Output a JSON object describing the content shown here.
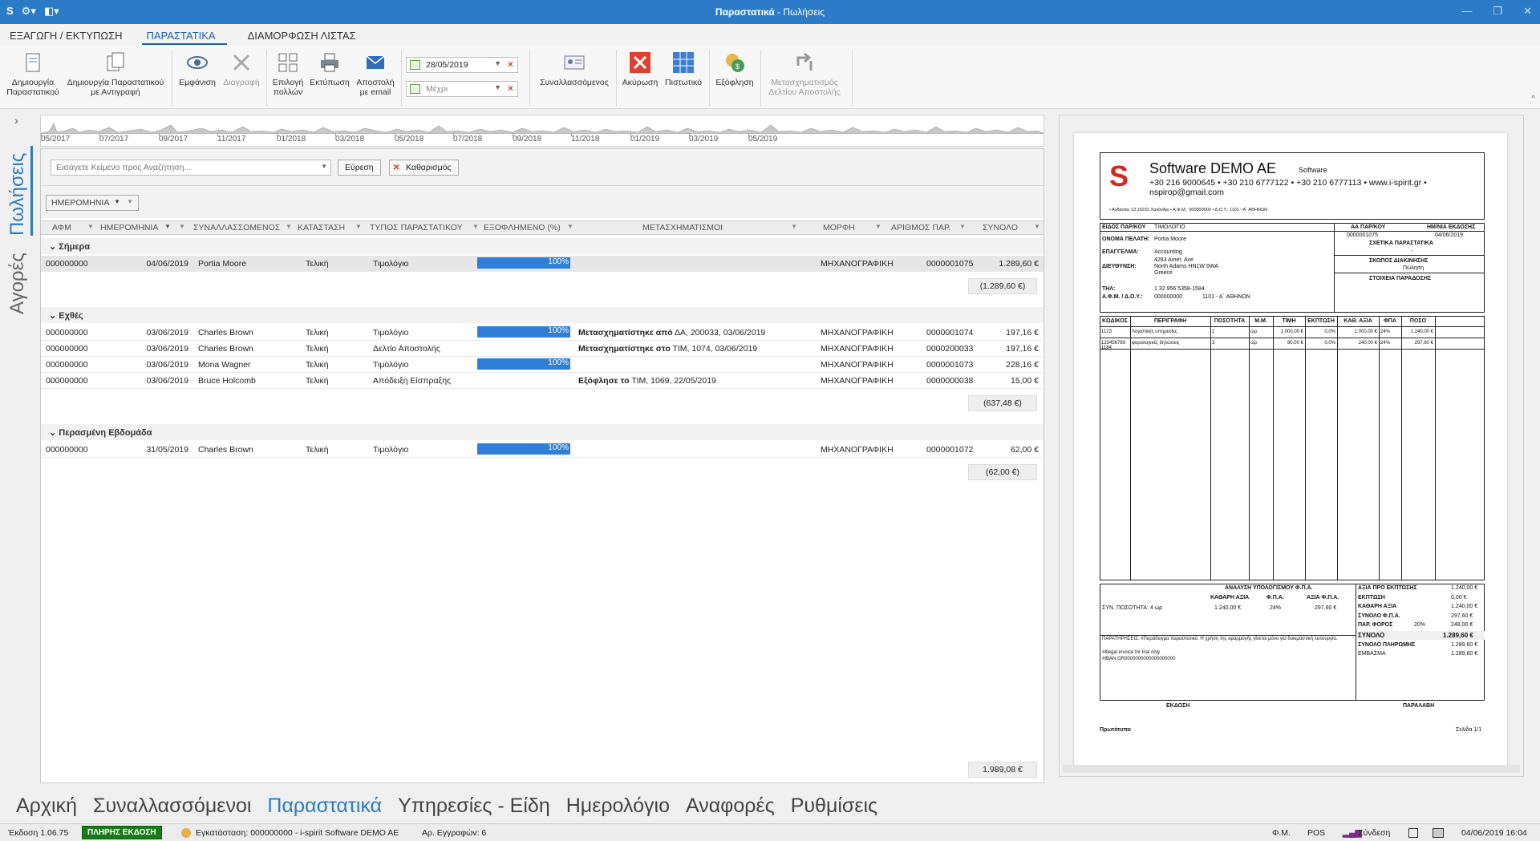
{
  "window": {
    "title": "Παραστατικά",
    "title_suffix": " - Πωλήσεις"
  },
  "ribbon_tabs": [
    "ΕΞΑΓΩΓΗ / ΕΚΤΥΠΩΣΗ",
    "ΠΑΡΑΣΤΑΤΙΚΑ",
    "ΔΙΑΜΟΡΦΩΣΗ ΛΙΣΤΑΣ"
  ],
  "ribbon": {
    "create": "Δημιουργία Παραστατικού",
    "create_copy": "Δημιουργία Παραστατικού με Αντιγραφή",
    "show": "Εμφάνιση",
    "delete": "Διαγραφή",
    "select_many": "Επιλογή πολλών",
    "print": "Εκτύπωση",
    "send_email": "Αποστολή με email",
    "date_from": "28/05/2019",
    "date_to_placeholder": "Μέχρι",
    "partners": "Συναλλασσόμενος",
    "cancel": "Ακύρωση",
    "credit": "Πιστωτικό",
    "settle": "Εξόφληση",
    "transform": "Μετασχηματισμός Δελτίου Αποστολής"
  },
  "timeline": {
    "labels": [
      "05/2017",
      "07/2017",
      "09/2017",
      "11/2017",
      "01/2018",
      "03/2018",
      "05/2018",
      "07/2018",
      "09/2018",
      "11/2018",
      "01/2019",
      "03/2019",
      "05/2019"
    ]
  },
  "side_tabs": {
    "sales": "Πωλήσεις",
    "purchases": "Αγορές"
  },
  "search": {
    "placeholder": "Εισάγετε Κείμενο προς Αναζήτηση...",
    "find": "Εύρεση",
    "clear": "Καθαρισμός"
  },
  "group_chip": "ΗΜΕΡΟΜΗΝΙΑ",
  "columns": [
    "ΑΦΜ",
    "ΗΜΕΡΟΜΗΝΙΑ",
    "ΣΥΝΑΛΛΑΣΣΟΜΕΝΟΣ",
    "ΚΑΤΑΣΤΑΣΗ",
    "ΤΥΠΟΣ ΠΑΡΑΣΤΑΤΙΚΟΥ",
    "ΕΞΟΦΛΗΜΕΝΟ (%)",
    "ΜΕΤΑΣΧΗΜΑΤΙΣΜΟΙ",
    "ΜΟΡΦΗ",
    "ΑΡΙΘΜΟΣ ΠΑΡ.",
    "ΣΥΝΟΛΟ"
  ],
  "groups": [
    {
      "title": "Σήμερα",
      "sum": "(1.289,60 €)",
      "rows": [
        {
          "afm": "000000000",
          "date": "04/06/2019",
          "partner": "Portia Moore",
          "status": "Τελική",
          "type": "Τιμολόγιο",
          "paid": "100%",
          "paid_pct": 100,
          "trans_bold": "",
          "trans": "",
          "form": "ΜΗΧΑΝΟΓΡΑΦΙΚΗ",
          "num": "0000001075",
          "total": "1.289,60 €"
        }
      ]
    },
    {
      "title": "Εχθές",
      "sum": "(637,48 €)",
      "rows": [
        {
          "afm": "000000000",
          "date": "03/06/2019",
          "partner": "Charles Brown",
          "status": "Τελική",
          "type": "Τιμολόγιο",
          "paid": "100%",
          "paid_pct": 100,
          "trans_bold": "Μετασχηματίστηκε από",
          "trans": " ΔΑ, 200033, 03/06/2019",
          "form": "ΜΗΧΑΝΟΓΡΑΦΙΚΗ",
          "num": "0000001074",
          "total": "197,16 €"
        },
        {
          "afm": "000000000",
          "date": "03/06/2019",
          "partner": "Charles Brown",
          "status": "Τελική",
          "type": "Δελτίο Αποστολής",
          "paid": "",
          "paid_pct": 0,
          "trans_bold": "Μετασχηματίστηκε στο",
          "trans": " ΤΙΜ, 1074, 03/06/2019",
          "form": "ΜΗΧΑΝΟΓΡΑΦΙΚΗ",
          "num": "0000200033",
          "total": "197,16 €"
        },
        {
          "afm": "000000000",
          "date": "03/06/2019",
          "partner": "Mona Wagner",
          "status": "Τελική",
          "type": "Τιμολόγιο",
          "paid": "100%",
          "paid_pct": 100,
          "trans_bold": "",
          "trans": "",
          "form": "ΜΗΧΑΝΟΓΡΑΦΙΚΗ",
          "num": "0000001073",
          "total": "228,16 €"
        },
        {
          "afm": "000000000",
          "date": "03/06/2019",
          "partner": "Bruce Holcomb",
          "status": "Τελική",
          "type": "Απόδειξη Είσπραξης",
          "paid": "",
          "paid_pct": 0,
          "trans_bold": "Εξόφλησε το",
          "trans": " ΤΙΜ, 1069, 22/05/2019",
          "form": "ΜΗΧΑΝΟΓΡΑΦΙΚΗ",
          "num": "0000000038",
          "total": "15,00 €"
        }
      ]
    },
    {
      "title": "Περασμένη Εβδομάδα",
      "sum": "(62,00 €)",
      "rows": [
        {
          "afm": "000000000",
          "date": "31/05/2019",
          "partner": "Charles Brown",
          "status": "Τελική",
          "type": "Τιμολόγιο",
          "paid": "100%",
          "paid_pct": 100,
          "trans_bold": "",
          "trans": "",
          "form": "ΜΗΧΑΝΟΓΡΑΦΙΚΗ",
          "num": "0000001072",
          "total": "62,00 €"
        }
      ]
    }
  ],
  "grand_total": "1.989,08 €",
  "invoice": {
    "company": "Software DEMO AE",
    "company_tag": "Software",
    "phones": "+30 216 9000645 • +30 210 6777122 • +30 210 6777113 • www.i-spirit.gr • nspirop@gmail.com",
    "address_line": "• Ανδανίας 13 15231 Χαλάνδρι • Α.Φ.Μ.: 000000000 • Δ.Ο.Υ.: 1101 - Α΄ ΑΘΗΝΩΝ",
    "doc_type_label": "ΕΙΔΟΣ ΠΑΡ/ΚΟΥ",
    "doc_type": "ΤΙΜΟΛΟΓΙΟ",
    "aa_label": "ΑΑ ΠΑΡ/ΚΟΥ",
    "aa": "0000001075",
    "date_label": "ΗΜ/ΝΙΑ ΕΚΔΟΣΗΣ",
    "date": "04/06/2019",
    "client_label": "ΟΝΟΜΑ ΠΕΛΑΤΗ:",
    "client": "Portia Moore",
    "job_label": "ΕΠΑΓΓΕΛΜΑ:",
    "job": "Accounting",
    "addr_label": "ΔΙΕΥΘΥΝΣΗ:",
    "addr1": "4283 Amet. Ave",
    "addr2": "North Adams HN1W 6WA",
    "addr3": "Greece",
    "phone_label": "ΤΗΛ:",
    "phone": "1 32 956 5358-1584",
    "afm_label": "Α.Φ.Μ. / Δ.Ο.Υ.:",
    "afm": "000000000",
    "doy": "1101 - Α΄ ΑΘΗΝΩΝ",
    "related_label": "ΣΧΕΤΙΚΑ ΠΑΡΑΣΤΑΤΙΚΑ",
    "related": "-",
    "purpose_label": "ΣΚΟΠΟΣ ΔΙΑΚΙΝΗΣΗΣ",
    "purpose": "Πώληση",
    "delivery_label": "ΣΤΟΙΧΕΙΑ ΠΑΡΑΔΟΣΗΣ",
    "item_cols": [
      "ΚΩΔΙΚΟΣ",
      "ΠΕΡΙΓΡΑΦΗ",
      "ΠΟΣΟΤΗΤΑ",
      "Μ.Μ.",
      "ΤΙΜΗ",
      "ΕΚΠΤΩΣΗ",
      "ΚΑΘ. ΑΞΙΑ",
      "ΦΠΑ",
      "ΠΟΣΟ"
    ],
    "items": [
      [
        "1123",
        "Λογιστικές υπηρεσίες",
        "1",
        "ώρ",
        "1.000,00 €",
        "0,0%",
        "1.000,00 €",
        "24%",
        "1.240,00 €"
      ],
      [
        "123456789\n1184",
        "φορολογικές δηλώσεις",
        "3",
        "ώρ",
        "80,00 €",
        "0,0%",
        "240,00 €",
        "24%",
        "297,60 €"
      ]
    ],
    "vat_title": "ΑΝΑΛΥΣΗ ΥΠΟΛΟΓΙΣΜΟΥ Φ.Π.Α.",
    "vat_cols": [
      "ΚΑΘΑΡΗ ΑΞΙΑ",
      "Φ.Π.Α.",
      "ΑΞΙΑ Φ.Π.Α."
    ],
    "vat_row": [
      "1.240,00 €",
      "24%",
      "297,60 €"
    ],
    "qty_sum": "ΣΥΝ. ΠΟΣΟΤΗΤΑ: 4 ώρ",
    "totals": [
      [
        "ΑΞΙΑ ΠΡΟ ΕΚΠΤΩΣΗΣ",
        "1.240,00 €"
      ],
      [
        "ΕΚΠΤΩΣΗ",
        "0,00 €"
      ],
      [
        "ΚΑΘΑΡΗ ΑΞΙΑ",
        "1.240,00 €"
      ],
      [
        "ΣΥΝΟΛΟ Φ.Π.Α.",
        "297,60 €"
      ],
      [
        "ΠΑΡ. ΦΟΡΟΣ",
        "248,00 €"
      ]
    ],
    "tax_pct": "20%",
    "grand_label": "ΣΥΝΟΛΟ",
    "grand": "1.289,60 €",
    "pay_label": "ΣΥΝΟΛΟ ΠΛΗΡΩΜΗΣ",
    "pay": "1.289,60 €",
    "deposit_label": "ΕΜΒΑΣΜΑ",
    "deposit": "1.289,60 €",
    "notes": "ΠΑΡΑΤΗΡΗΣΕΙΣ: #Παράδειγμα παραστατικό. Η χρήση της εφαρμογής γίνεται μόνο για δοκιμαστική λειτουργία.",
    "notes2": "#Illegal invoice for trial only",
    "notes3": "#IBAN GR0000000000000000000",
    "issue": "ΕΚΔΟΣΗ",
    "receive": "ΠΑΡΑΛΑΒΗ",
    "original": "Πρωτότυπο",
    "page": "Σελίδα 1/1"
  },
  "bottom_nav": [
    "Αρχική",
    "Συναλλασσόμενοι",
    "Παραστατικά",
    "Υπηρεσίες - Είδη",
    "Ημερολόγιο",
    "Αναφορές",
    "Ρυθμίσεις"
  ],
  "status": {
    "version": "Έκδοση 1.06.75",
    "edition": "ΠΛΗΡΗΣ ΕΚΔΟΣΗ",
    "install": "Εγκατάσταση: 000000000 - i-spirit Software DEMO AE",
    "records": "Αρ. Εγγραφών: 6",
    "fm": "Φ.Μ.",
    "pos": "POS",
    "connect": "Σύνδεση",
    "datetime": "04/06/2019 16:04"
  }
}
